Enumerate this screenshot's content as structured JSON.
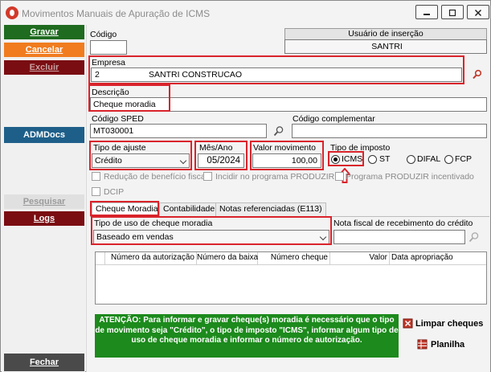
{
  "window": {
    "title": "Movimentos Manuais de Apuração de ICMS"
  },
  "sidebar": {
    "gravar": "Gravar",
    "cancelar": "Cancelar",
    "excluir": "Excluir",
    "admdocs": "ADMDocs",
    "pesquisar": "Pesquisar",
    "logs": "Logs",
    "fechar": "Fechar"
  },
  "form": {
    "codigo_label": "Código",
    "codigo_value": "",
    "usuario_label": "Usuário de inserção",
    "usuario_value": "SANTRI",
    "empresa_label": "Empresa",
    "empresa_code": "2",
    "empresa_name": "SANTRI CONSTRUCAO",
    "descricao_label": "Descrição",
    "descricao_value": "Cheque moradia",
    "codigo_sped_label": "Código SPED",
    "codigo_sped_value": "MT030001",
    "codigo_compl_label": "Código complementar",
    "codigo_compl_value": "",
    "tipo_ajuste_label": "Tipo de ajuste",
    "tipo_ajuste_value": "Crédito",
    "mes_ano_label": "Mês/Ano",
    "mes_ano_value": "05/2024",
    "valor_label": "Valor movimento",
    "valor_value": "100,00",
    "tipo_imposto_label": "Tipo de imposto",
    "tipo_imposto_options": [
      "ICMS",
      "ST",
      "DIFAL",
      "FCP"
    ],
    "tipo_imposto_selected": "ICMS",
    "reducao_label": "Redução de benefício fiscal",
    "incidir_label": "Incidir no programa PRODUZIR",
    "programa_label": "Programa PRODUZIR incentivado",
    "dcip_label": "DCIP"
  },
  "tabs": [
    "Cheque Moradia",
    "Contabilidade",
    "Notas referenciadas (E113)"
  ],
  "cheque": {
    "tipo_uso_label": "Tipo de uso de cheque moradia",
    "tipo_uso_value": "Baseado em vendas",
    "nota_fiscal_label": "Nota fiscal de recebimento do crédito",
    "nota_fiscal_value": "",
    "columns": [
      "Número da autorização",
      "Número da baixa",
      "Número cheque",
      "Valor",
      "Data apropriação"
    ],
    "notice": "ATENÇÃO: Para informar e gravar cheque(s) moradia é necessário que o tipo de movimento seja \"Crédito\", o tipo de imposto \"ICMS\", informar algum tipo de uso de cheque moradia e informar o número de autorização.",
    "limpar_cheques": "Limpar cheques",
    "planilha": "Planilha"
  },
  "colors": {
    "gravar_bg": "#1f6b1f",
    "cancelar_bg": "#f07c1f",
    "excluir_bg": "#7a0d12",
    "admdocs_bg": "#1e5f8a",
    "fechar_bg": "#4a4a4a",
    "highlight": "#d9232b",
    "notice_bg": "#1c8a1c"
  }
}
